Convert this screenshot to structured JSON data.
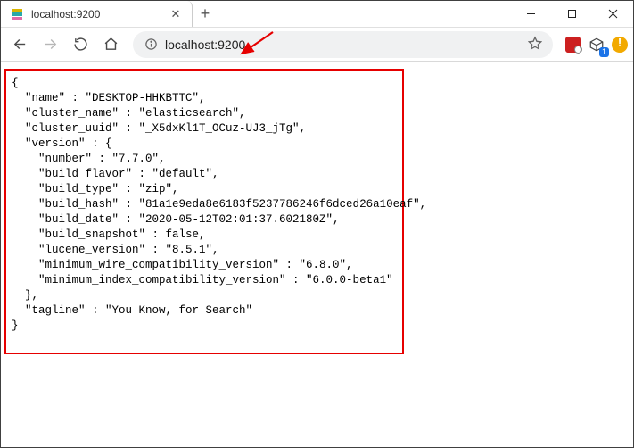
{
  "tab": {
    "title": "localhost:9200"
  },
  "address": {
    "url": "localhost:9200"
  },
  "ext": {
    "cube_badge": "1"
  },
  "json": {
    "text": "{\n  \"name\" : \"DESKTOP-HHKBTTC\",\n  \"cluster_name\" : \"elasticsearch\",\n  \"cluster_uuid\" : \"_X5dxKl1T_OCuz-UJ3_jTg\",\n  \"version\" : {\n    \"number\" : \"7.7.0\",\n    \"build_flavor\" : \"default\",\n    \"build_type\" : \"zip\",\n    \"build_hash\" : \"81a1e9eda8e6183f5237786246f6dced26a10eaf\",\n    \"build_date\" : \"2020-05-12T02:01:37.602180Z\",\n    \"build_snapshot\" : false,\n    \"lucene_version\" : \"8.5.1\",\n    \"minimum_wire_compatibility_version\" : \"6.8.0\",\n    \"minimum_index_compatibility_version\" : \"6.0.0-beta1\"\n  },\n  \"tagline\" : \"You Know, for Search\"\n}"
  }
}
